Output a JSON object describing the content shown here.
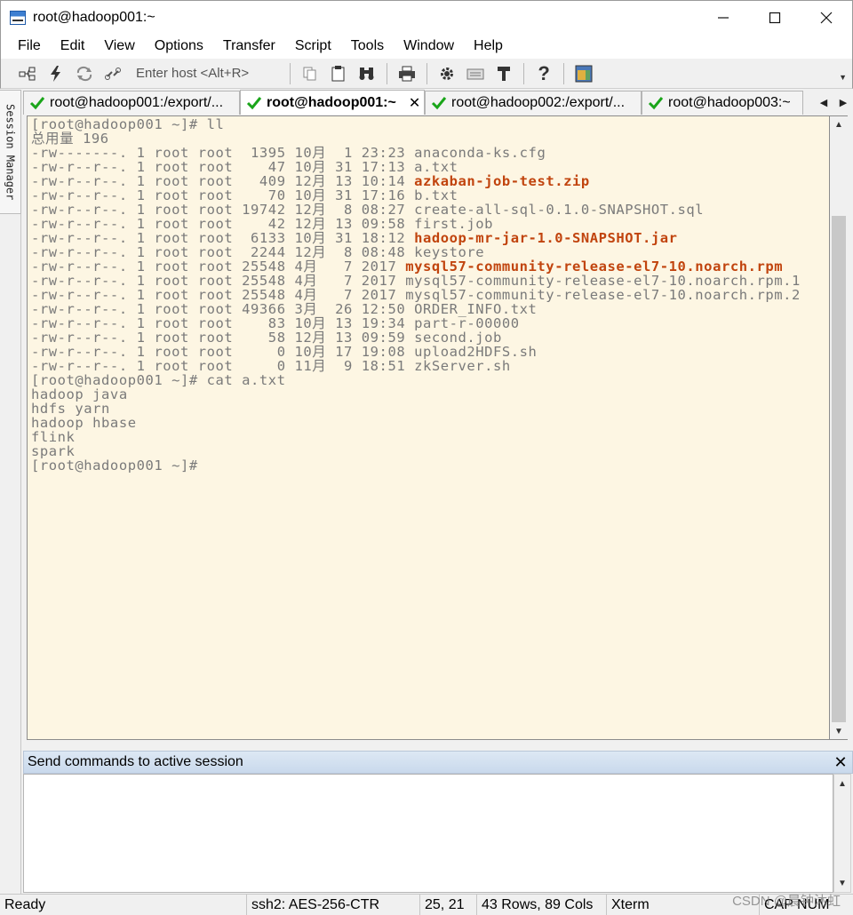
{
  "window": {
    "title": "root@hadoop001:~"
  },
  "menu": [
    "File",
    "Edit",
    "View",
    "Options",
    "Transfer",
    "Script",
    "Tools",
    "Window",
    "Help"
  ],
  "toolbar": {
    "enter_host_placeholder": "Enter host <Alt+R>"
  },
  "session_manager": {
    "label": "Session Manager"
  },
  "tabs": [
    {
      "label": "root@hadoop001:/export/...",
      "active": false
    },
    {
      "label": "root@hadoop001:~",
      "active": true
    },
    {
      "label": "root@hadoop002:/export/...",
      "active": false
    },
    {
      "label": "root@hadoop003:~",
      "active": false
    }
  ],
  "terminal": {
    "lines": [
      {
        "text": "[root@hadoop001 ~]# ll"
      },
      {
        "text": "总用量 196"
      },
      {
        "text": "-rw-------. 1 root root  1395 10月  1 23:23 ",
        "file": "anaconda-ks.cfg",
        "highlight": false
      },
      {
        "text": "-rw-r--r--. 1 root root    47 10月 31 17:13 ",
        "file": "a.txt",
        "highlight": false
      },
      {
        "text": "-rw-r--r--. 1 root root   409 12月 13 10:14 ",
        "file": "azkaban-job-test.zip",
        "highlight": true
      },
      {
        "text": "-rw-r--r--. 1 root root    70 10月 31 17:16 ",
        "file": "b.txt",
        "highlight": false
      },
      {
        "text": "-rw-r--r--. 1 root root 19742 12月  8 08:27 ",
        "file": "create-all-sql-0.1.0-SNAPSHOT.sql",
        "highlight": false
      },
      {
        "text": "-rw-r--r--. 1 root root    42 12月 13 09:58 ",
        "file": "first.job",
        "highlight": false
      },
      {
        "text": "-rw-r--r--. 1 root root  6133 10月 31 18:12 ",
        "file": "hadoop-mr-jar-1.0-SNAPSHOT.jar",
        "highlight": true
      },
      {
        "text": "-rw-r--r--. 1 root root  2244 12月  8 08:48 ",
        "file": "keystore",
        "highlight": false
      },
      {
        "text": "-rw-r--r--. 1 root root 25548 4月   7 2017 ",
        "file": "mysql57-community-release-el7-10.noarch.rpm",
        "highlight": true
      },
      {
        "text": "-rw-r--r--. 1 root root 25548 4月   7 2017 ",
        "file": "mysql57-community-release-el7-10.noarch.rpm.1",
        "highlight": false
      },
      {
        "text": "-rw-r--r--. 1 root root 25548 4月   7 2017 ",
        "file": "mysql57-community-release-el7-10.noarch.rpm.2",
        "highlight": false
      },
      {
        "text": "-rw-r--r--. 1 root root 49366 3月  26 12:50 ",
        "file": "ORDER_INFO.txt",
        "highlight": false
      },
      {
        "text": "-rw-r--r--. 1 root root    83 10月 13 19:34 ",
        "file": "part-r-00000",
        "highlight": false
      },
      {
        "text": "-rw-r--r--. 1 root root    58 12月 13 09:59 ",
        "file": "second.job",
        "highlight": false
      },
      {
        "text": "-rw-r--r--. 1 root root     0 10月 17 19:08 ",
        "file": "upload2HDFS.sh",
        "highlight": false
      },
      {
        "text": "-rw-r--r--. 1 root root     0 11月  9 18:51 ",
        "file": "zkServer.sh",
        "highlight": false
      },
      {
        "text": "[root@hadoop001 ~]# cat a.txt"
      },
      {
        "text": "hadoop java"
      },
      {
        "text": "hdfs yarn"
      },
      {
        "text": "hadoop hbase"
      },
      {
        "text": "flink"
      },
      {
        "text": "spark"
      },
      {
        "text": "[root@hadoop001 ~]#"
      }
    ]
  },
  "send_commands": {
    "title": "Send commands to active session"
  },
  "status": {
    "ready": "Ready",
    "cipher": "ssh2: AES-256-CTR",
    "cursor": "25,  21",
    "size": "43 Rows, 89 Cols",
    "term": "Xterm",
    "keys": "CAP  NUM"
  },
  "watermark": "CSDN @晨钟沐虹"
}
